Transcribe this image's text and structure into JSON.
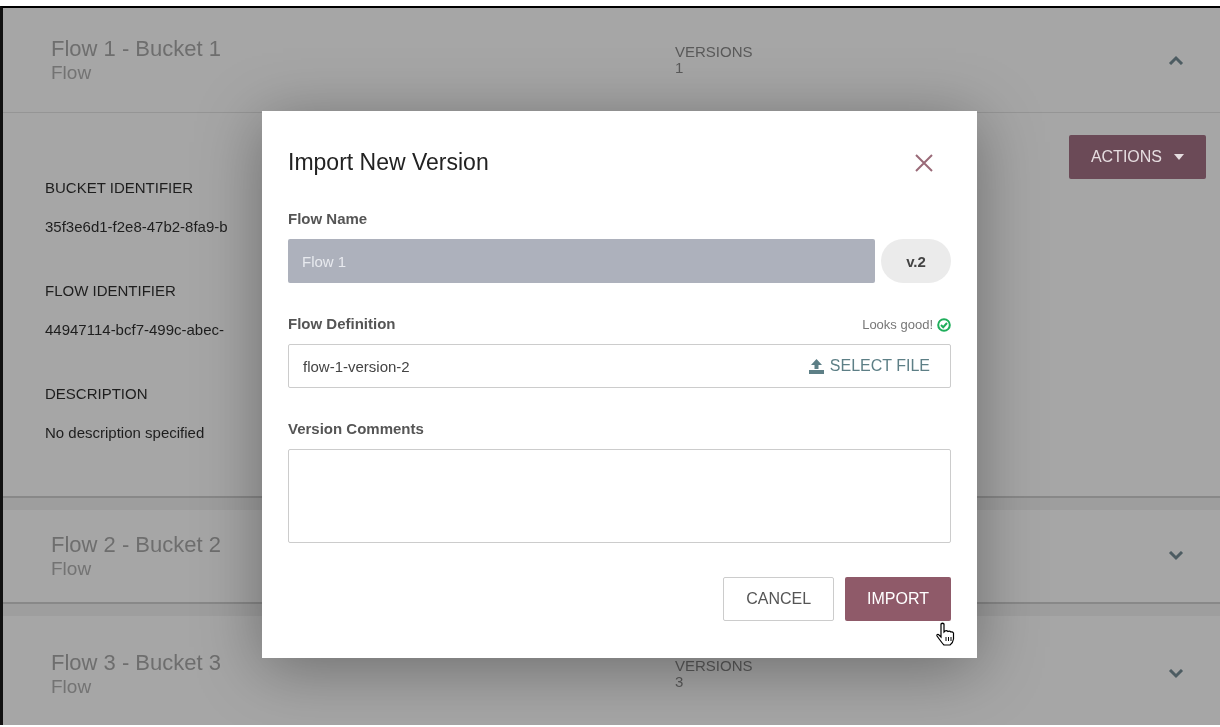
{
  "flows": [
    {
      "title": "Flow 1 - Bucket 1",
      "subtitle": "Flow",
      "versions_label": "VERSIONS",
      "versions": "1",
      "expanded": true,
      "actions": "ACTIONS",
      "details": [
        {
          "label": "BUCKET IDENTIFIER",
          "value": "35f3e6d1-f2e8-47b2-8fa9-b"
        },
        {
          "label": "FLOW IDENTIFIER",
          "value": "44947114-bcf7-499c-abec-"
        },
        {
          "label": "DESCRIPTION",
          "value": "No description specified"
        }
      ]
    },
    {
      "title": "Flow 2 - Bucket 2",
      "subtitle": "Flow",
      "expanded": false
    },
    {
      "title": "Flow 3 - Bucket 3",
      "subtitle": "Flow",
      "versions_label": "VERSIONS",
      "versions": "3",
      "expanded": false
    }
  ],
  "dialog": {
    "title": "Import New Version",
    "flow_name": {
      "label": "Flow Name",
      "placeholder": "Flow 1",
      "disabled": true,
      "version": "v.2"
    },
    "flow_definition": {
      "label": "Flow Definition",
      "status": "Looks good!",
      "value": "flow-1-version-2",
      "button": "SELECT FILE"
    },
    "comments": {
      "label": "Version Comments"
    },
    "buttons": [
      {
        "label": "CANCEL",
        "kind": "secondary"
      },
      {
        "label": "IMPORT",
        "kind": "primary"
      }
    ]
  }
}
